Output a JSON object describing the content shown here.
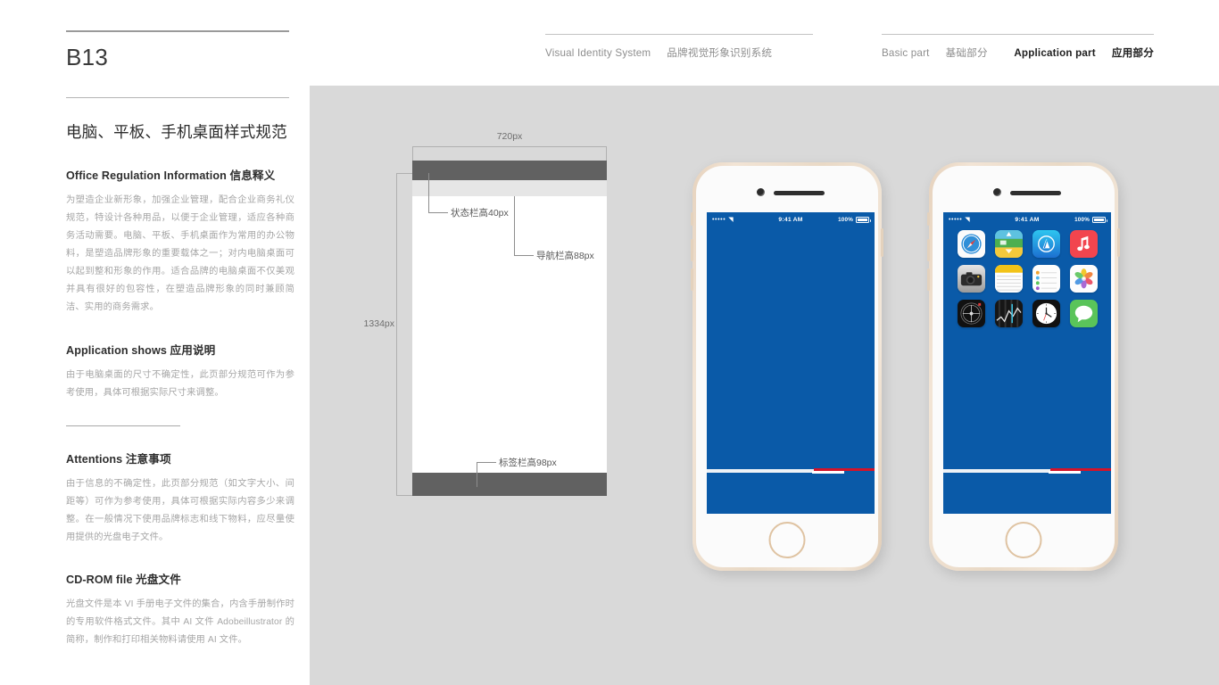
{
  "page": {
    "code": "B13",
    "title": "电脑、平板、手机桌面样式规范"
  },
  "header": {
    "system_en": "Visual Identity System",
    "system_cn": "品牌视觉形象识别系统",
    "basic_en": "Basic part",
    "basic_cn": "基础部分",
    "application_en": "Application part",
    "application_cn": "应用部分"
  },
  "sections": [
    {
      "heading": "Office Regulation Information 信息释义",
      "body": "为塑造企业新形象，加强企业管理，配合企业商务礼仪规范，特设计各种用品，以便于企业管理，适应各种商务活动需要。电脑、平板、手机桌面作为常用的办公物料，是塑造品牌形象的重要载体之一；对内电脑桌面可以起到整和形象的作用。适合品牌的电脑桌面不仅美观并具有很好的包容性，在塑造品牌形象的同时兼顾简洁、实用的商务需求。"
    },
    {
      "heading": "Application shows 应用说明",
      "body": "由于电脑桌面的尺寸不确定性，此页部分规范可作为参考使用，具体可根据实际尺寸来调整。"
    },
    {
      "heading": "Attentions 注意事项",
      "body": "由于信息的不确定性，此页部分规范（如文字大小、间距等）可作为参考使用，具体可根据实际内容多少来调整。在一般情况下使用品牌标志和线下物料，应尽量使用提供的光盘电子文件。"
    },
    {
      "heading": "CD-ROM file 光盘文件",
      "body": "光盘文件是本 VI 手册电子文件的集合，内含手册制作时的专用软件格式文件。其中 AI 文件 Adobeillustrator 的简称，制作和打印相关物料请使用 AI 文件。"
    }
  ],
  "wireframe": {
    "width_label": "720px",
    "height_label": "1334px",
    "status_bar_label": "状态栏高40px",
    "nav_bar_label": "导航栏高88px",
    "tab_bar_label": "标签栏高98px"
  },
  "phone": {
    "status": {
      "signal": "•••••",
      "wifi": "◥",
      "time": "9:41 AM",
      "battery": "100%"
    },
    "apps": [
      {
        "name": "safari",
        "label": "Safari"
      },
      {
        "name": "maps",
        "label": "Maps"
      },
      {
        "name": "app-store",
        "label": "App Store"
      },
      {
        "name": "music",
        "label": "Music"
      },
      {
        "name": "camera",
        "label": "Camera"
      },
      {
        "name": "notes",
        "label": "Notes"
      },
      {
        "name": "reminders",
        "label": "Reminders"
      },
      {
        "name": "photos",
        "label": "Photos"
      },
      {
        "name": "compass",
        "label": "Compass"
      },
      {
        "name": "stocks",
        "label": "Stocks"
      },
      {
        "name": "clock",
        "label": "Clock"
      },
      {
        "name": "messages",
        "label": "Messages"
      }
    ]
  },
  "colors": {
    "panel_gray": "#d9d9d9",
    "wallpaper_blue": "#0a5aa8",
    "accent_red": "#d3132a",
    "bezel_gold": "#e9d9c6",
    "wire_dark": "#616161"
  }
}
